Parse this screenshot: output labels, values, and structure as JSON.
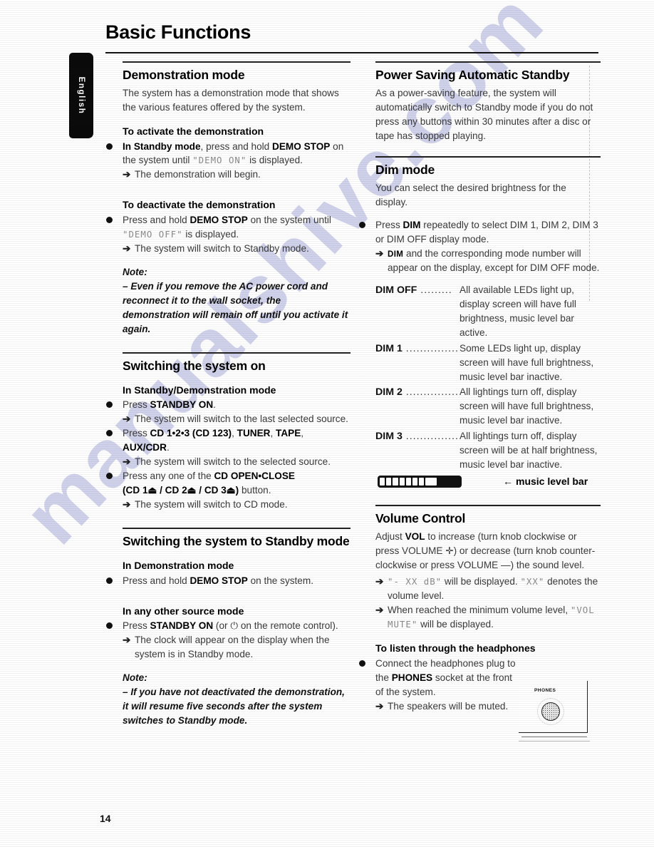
{
  "page": {
    "title": "Basic Functions",
    "language_tab": "English",
    "number": "14",
    "watermark": "manualshive.com"
  },
  "left_column": {
    "demonstration": {
      "heading": "Demonstration mode",
      "intro": "The system has a demonstration mode that shows the various features offered by the system.",
      "activate_heading": "To activate the demonstration",
      "activate_line1_a": "In Standby mode",
      "activate_line1_b": ", press and hold ",
      "activate_line1_c": "DEMO STOP",
      "activate_line1_d": " on the system until ",
      "activate_display": "\"DEMO ON\"",
      "activate_line1_e": " is displayed.",
      "activate_result": "The demonstration will begin.",
      "deactivate_heading": "To deactivate the demonstration",
      "deactivate_a": "Press and hold ",
      "deactivate_b": "DEMO STOP",
      "deactivate_c": " on the system until ",
      "deactivate_display": "\"DEMO OFF\"",
      "deactivate_d": " is displayed.",
      "deactivate_result": "The system will switch to Standby mode.",
      "note_label": "Note:",
      "note_text": "–  Even if you remove the AC power cord and reconnect it to the wall socket, the demonstration will remain off until you activate it again."
    },
    "switching_on": {
      "heading": "Switching the system on",
      "sub_heading": "In Standby/Demonstration mode",
      "b1_a": "Press ",
      "b1_b": "STANDBY ON",
      "b1_c": ".",
      "b1_result": "The system will switch to the last selected source.",
      "b2_a": "Press ",
      "b2_b": "CD 1•2•3 (CD 123)",
      "b2_c": ", ",
      "b2_d": "TUNER",
      "b2_e": ", ",
      "b2_f": "TAPE",
      "b2_g": ", ",
      "b2_h": "AUX/CDR",
      "b2_i": ".",
      "b2_result": "The system will switch to the selected source.",
      "b3_a": "Press any one of the ",
      "b3_b": "CD OPEN•CLOSE",
      "b3_c": "(CD 1⏏ / CD 2⏏ / CD 3⏏)",
      "b3_d": " button.",
      "b3_result": "The system will switch to CD mode."
    },
    "switching_standby": {
      "heading": "Switching the system to Standby mode",
      "sub_heading_1": "In Demonstration mode",
      "b1_a": "Press and hold ",
      "b1_b": "DEMO STOP",
      "b1_c": " on the system.",
      "sub_heading_2": "In any other source mode",
      "b2_a": "Press ",
      "b2_b": "STANDBY ON",
      "b2_c": " (or ",
      "b2_power_icon": "⏻",
      "b2_d": " on the remote control).",
      "b2_result": "The clock will appear on the display when the system is in Standby mode.",
      "note_label": "Note:",
      "note_text": "–  If you have not deactivated the demonstration, it will resume five seconds after the system switches to Standby mode."
    }
  },
  "right_column": {
    "power_saving": {
      "heading": "Power Saving Automatic Standby",
      "text": "As a power-saving feature, the system will automatically switch to Standby mode if you do not press any buttons within 30 minutes after a disc or tape has stopped playing."
    },
    "dim_mode": {
      "heading": "Dim mode",
      "intro": "You can select the desired brightness for the display.",
      "b1_a": "Press ",
      "b1_b": "DIM",
      "b1_c": " repeatedly to select DIM 1, DIM 2, DIM 3 or DIM OFF display mode.",
      "b1_result_a": "DIM",
      "b1_result_b": " and the corresponding mode number will appear on the display, except for DIM OFF mode.",
      "table": [
        {
          "key": "DIM OFF",
          "dots": " .........",
          "value": "All available LEDs light up, display screen will have full brightness, music level bar active."
        },
        {
          "key": "DIM 1",
          "dots": " ...............",
          "value": "Some LEDs light up, display screen will have full brightness, music level bar inactive."
        },
        {
          "key": "DIM 2",
          "dots": " ...............",
          "value": "All lightings turn off, display screen will have full brightness, music level bar inactive."
        },
        {
          "key": "DIM 3",
          "dots": " ...............",
          "value": "All lightings turn off, display screen will be at half brightness, music level bar inactive."
        }
      ],
      "music_level_bar_label": "music level bar",
      "music_level_bar_arrow": "←"
    },
    "volume_control": {
      "heading": "Volume Control",
      "text_a": "Adjust ",
      "text_b": "VOL",
      "text_c": " to increase (turn knob clockwise or press VOLUME ✛) or decrease (turn knob counter-clockwise or press VOLUME ―) the sound level.",
      "result1_a": "\"- XX dB\"",
      "result1_b": " will be displayed. ",
      "result1_c": "\"XX\"",
      "result1_d": " denotes the volume level.",
      "result2_a": "When reached the minimum volume level, ",
      "result2_b": "\"VOL MUTE\"",
      "result2_c": " will be displayed.",
      "headphones_heading": "To listen through the headphones",
      "headphones_a": "Connect the headphones plug to the ",
      "headphones_b": "PHONES",
      "headphones_c": " socket at the front of the system.",
      "headphones_result": "The speakers will be muted.",
      "phones_socket_label": "PHONES"
    }
  }
}
